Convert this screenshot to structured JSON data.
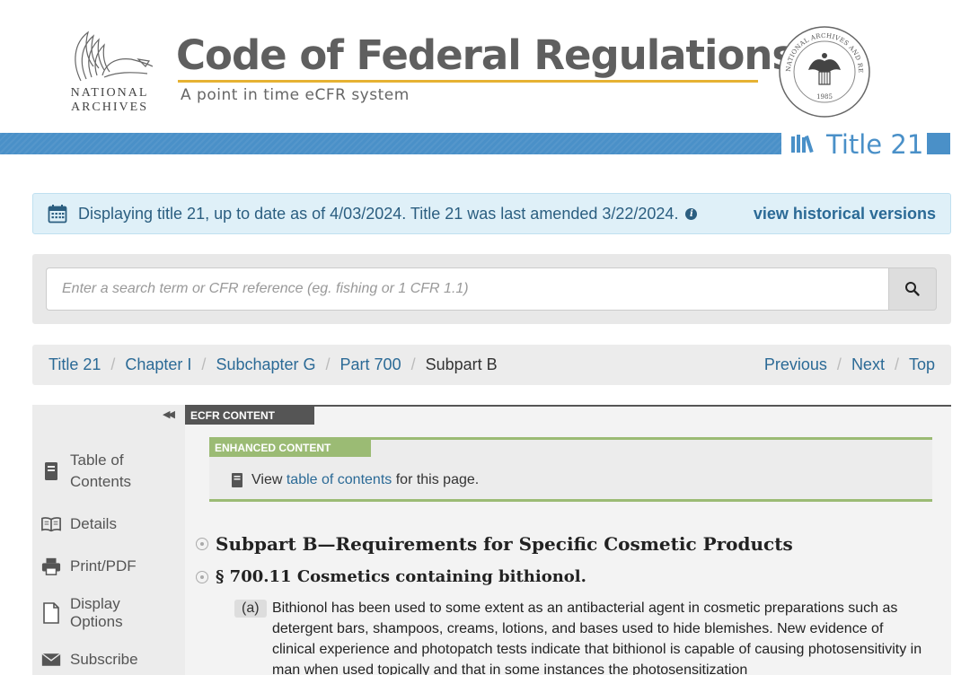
{
  "header": {
    "logo_text_line1": "NATIONAL",
    "logo_text_line2": "ARCHIVES",
    "site_title": "Code of Federal Regulations",
    "site_subtitle": "A point in time eCFR system",
    "seal_top_text": "NATIONAL ARCHIVES AND RECORDS ADMINISTRATION",
    "seal_year": "1985"
  },
  "title_band": {
    "label": "Title 21"
  },
  "info_banner": {
    "text": "Displaying title 21, up to date as of 4/03/2024. Title 21 was last amended 3/22/2024.",
    "link": "view historical versions"
  },
  "search": {
    "placeholder": "Enter a search term or CFR reference (eg. fishing or 1 CFR 1.1)",
    "value": ""
  },
  "breadcrumb": {
    "items": [
      "Title 21",
      "Chapter I",
      "Subchapter G",
      "Part 700"
    ],
    "current": "Subpart B",
    "nav": [
      "Previous",
      "Next",
      "Top"
    ]
  },
  "sidebar": {
    "collapse_symbol": "◀◀",
    "items": [
      {
        "label_line1": "Table of",
        "label_line2": "Contents",
        "icon": "book-icon"
      },
      {
        "label_line1": "Details",
        "label_line2": "",
        "icon": "open-book-icon"
      },
      {
        "label_line1": "Print/PDF",
        "label_line2": "",
        "icon": "printer-icon"
      },
      {
        "label_line1": "Display",
        "label_line2": "Options",
        "icon": "document-icon"
      },
      {
        "label_line1": "Subscribe",
        "label_line2": "",
        "icon": "envelope-icon"
      }
    ]
  },
  "content": {
    "ecfr_tab": "ECFR CONTENT",
    "enhanced_tab": "ENHANCED CONTENT",
    "enhanced_prefix": "View",
    "enhanced_link": "table of contents",
    "enhanced_suffix": "for this page.",
    "subpart_heading": "Subpart B—Requirements for Specific Cosmetic Products",
    "section_heading": "§ 700.11 Cosmetics containing bithionol.",
    "paragraph_label": "(a)",
    "paragraph_text": "Bithionol has been used to some extent as an antibacterial agent in cosmetic preparations such as detergent bars, shampoos, creams, lotions, and bases used to hide blemishes. New evidence of clinical experience and photopatch tests indicate that bithionol is capable of causing photosensitivity in man when used topically and that in some instances the photosensitization"
  },
  "colors": {
    "brand_blue": "#4a90c8",
    "gold_rule": "#e6b233",
    "link": "#2b6a96",
    "enhanced_green": "#9bbb74"
  }
}
